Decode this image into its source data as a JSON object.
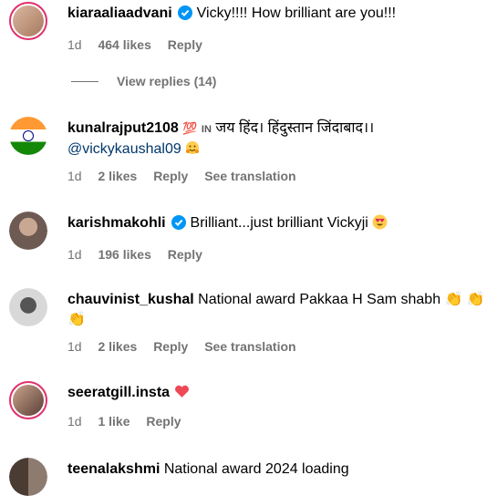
{
  "comments": [
    {
      "username": "kiaraaliaadvani",
      "verified": true,
      "text": "Vicky!!!! How brilliant are you!!!",
      "time": "1d",
      "likes": "464 likes",
      "reply": "Reply"
    },
    {
      "username": "kunalrajput2108",
      "text_prefix_emoji": "💯",
      "text_flag": "IN",
      "text": "जय हिंद। हिंदुस्तान जिंदाबाद।।",
      "mention": "@vickykaushal09",
      "time": "1d",
      "likes": "2 likes",
      "reply": "Reply",
      "translate": "See translation"
    },
    {
      "username": "karishmakohli",
      "verified": true,
      "text": "Brilliant...just brilliant Vickyji",
      "time": "1d",
      "likes": "196 likes",
      "reply": "Reply"
    },
    {
      "username": "chauvinist_kushal",
      "text": "National award Pakkaa H Sam shabh",
      "time": "1d",
      "likes": "2 likes",
      "reply": "Reply",
      "translate": "See translation"
    },
    {
      "username": "seeratgill.insta",
      "time": "1d",
      "likes": "1 like",
      "reply": "Reply"
    },
    {
      "username": "teenalakshmi",
      "text": "National award 2024 loading"
    }
  ],
  "view_replies": "View replies (14)",
  "colors": {
    "link": "#00376b",
    "meta": "#737373",
    "story_ring": "#e1306c",
    "heart": "#ed4956",
    "verified": "#0095f6"
  }
}
